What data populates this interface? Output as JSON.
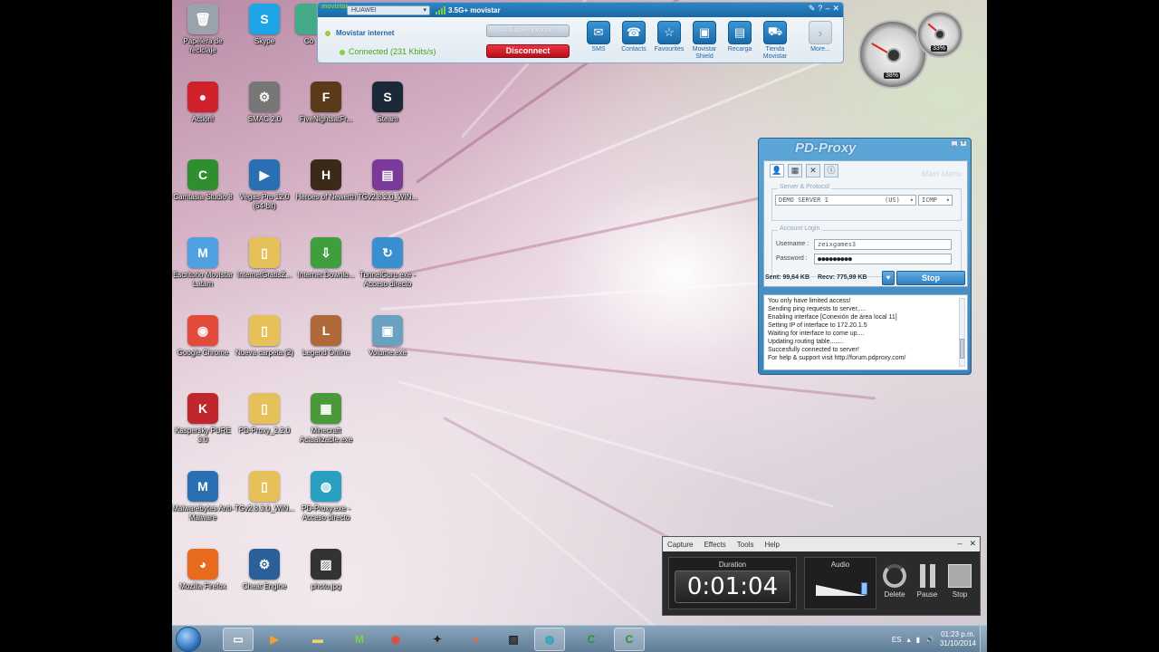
{
  "desktop_icons": [
    {
      "label": "Papelera de reciclaje",
      "color": "#9aa3ab",
      "glyph": "🗑"
    },
    {
      "label": "Skype",
      "color": "#1ea5e8",
      "glyph": "S"
    },
    {
      "label": "Co",
      "color": "#4a8",
      "glyph": ""
    },
    {
      "label": "Action!",
      "color": "#d0202a",
      "glyph": "●"
    },
    {
      "label": "SMAC 2.0",
      "color": "#777",
      "glyph": "⚙"
    },
    {
      "label": "FiveNightsatFr...",
      "color": "#5a3a1a",
      "glyph": "F"
    },
    {
      "label": "Steam",
      "color": "#1b2838",
      "glyph": "S"
    },
    {
      "label": "Camtasia Studio 8",
      "color": "#2f8f2f",
      "glyph": "C"
    },
    {
      "label": "Vegas Pro 12.0 (64-bit)",
      "color": "#2b6fb3",
      "glyph": "▶"
    },
    {
      "label": "Heroes of Newerth",
      "color": "#3a2a1a",
      "glyph": "H"
    },
    {
      "label": "TGv2.8.2.0_WIN...",
      "color": "#7b3a9a",
      "glyph": "▤"
    },
    {
      "label": "Escritorio Movistar Latam",
      "color": "#4fa1e0",
      "glyph": "M"
    },
    {
      "label": "InternetGratisZ...",
      "color": "#e6c15a",
      "glyph": "▯"
    },
    {
      "label": "Internet Downlo...",
      "color": "#3f9f3f",
      "glyph": "⇩"
    },
    {
      "label": "TunnelGuru.exe - Acceso directo",
      "color": "#3a8fd0",
      "glyph": "↻"
    },
    {
      "label": "Google Chrome",
      "color": "#e24a3b",
      "glyph": "◉"
    },
    {
      "label": "Nueva carpeta (2)",
      "color": "#e6c15a",
      "glyph": "▯"
    },
    {
      "label": "Legend Online",
      "color": "#b06a3a",
      "glyph": "L"
    },
    {
      "label": "Volume.exe",
      "color": "#6aa0c0",
      "glyph": "▣"
    },
    {
      "label": "Kaspersky PURE 3.0",
      "color": "#c0262d",
      "glyph": "K"
    },
    {
      "label": "PD-Proxy_2.2.0",
      "color": "#e6c15a",
      "glyph": "▯"
    },
    {
      "label": "Minecraft Actualizable.exe",
      "color": "#4a9a3a",
      "glyph": "▦"
    },
    {
      "label": "Malwarebytes Anti-Malware",
      "color": "#2b6fb3",
      "glyph": "M"
    },
    {
      "label": "TGv2.8.3.0_WIN...",
      "color": "#e6c15a",
      "glyph": "▯"
    },
    {
      "label": "PD-Proxy.exe - Acceso directo",
      "color": "#2aa0c0",
      "glyph": "◍"
    },
    {
      "label": "Mozilla Firefox",
      "color": "#e86a1f",
      "glyph": "◕"
    },
    {
      "label": "Cheat Engine",
      "color": "#2b5f9a",
      "glyph": "⚙"
    },
    {
      "label": "photo.jpg",
      "color": "#333",
      "glyph": "▨"
    }
  ],
  "movistar": {
    "logo": "movistar",
    "device": "HUAWEI",
    "signal": "3.5G+ movistar",
    "network_name": "Movistar internet",
    "status": "Connected (231 Kbits/s)",
    "available_networks": "Available networks",
    "disconnect": "Disconnect",
    "buttons": [
      {
        "label": "SMS",
        "icon": "envelope-icon",
        "glyph": "✉"
      },
      {
        "label": "Contacts",
        "icon": "contacts-icon",
        "glyph": "☎"
      },
      {
        "label": "Favourites",
        "icon": "star-icon",
        "glyph": "☆"
      },
      {
        "label": "Movistar Shield",
        "icon": "shield-icon",
        "glyph": "▣"
      },
      {
        "label": "Recarga",
        "icon": "recharge-icon",
        "glyph": "▤"
      },
      {
        "label": "Tienda Movistar",
        "icon": "cart-icon",
        "glyph": "⛟"
      },
      {
        "label": "More...",
        "icon": "chevron-right-icon",
        "glyph": "›"
      }
    ],
    "accent": "#1a6aa9"
  },
  "gauges": {
    "big_value": "38%",
    "small_value": "33%"
  },
  "pdproxy": {
    "title": "PD-Proxy",
    "main_menu": "Main Menu",
    "server_legend": "Server & Protocol",
    "server": "DEMO SERVER 1",
    "region": "(US)",
    "protocol": "ICMP",
    "account_legend": "Account Login",
    "username_label": "Username :",
    "username": "zeixgames3",
    "password_label": "Password :",
    "password": "●●●●●●●●●",
    "sent": "Sent: 99,64 KB",
    "recv": "Recv: 775,99 KB",
    "stop": "Stop",
    "log": [
      "You only have limited access!",
      "Sending ping requests to server.....",
      "Enabling interface [Conexión de área local 11]",
      "Setting IP of interface to 172.20.1.5",
      "Waiting for interface to come up....",
      "Updating routing table........",
      "Succesfully connected to server!",
      "For help & support visit http://forum.pdproxy.com/"
    ]
  },
  "recorder": {
    "menu": [
      "Capture",
      "Effects",
      "Tools",
      "Help"
    ],
    "duration_label": "Duration",
    "duration": "0:01:04",
    "audio_label": "Audio",
    "delete": "Delete",
    "pause": "Pause",
    "stop": "Stop"
  },
  "taskbar": {
    "language": "ES",
    "time": "01:23 p.m.",
    "date": "31/10/2014"
  }
}
